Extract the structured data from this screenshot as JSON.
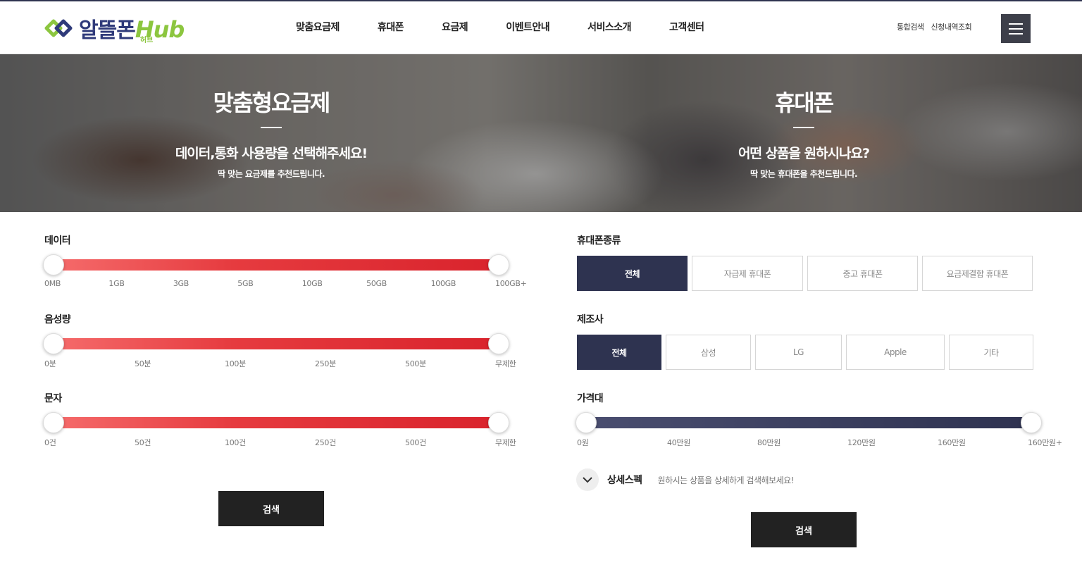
{
  "header": {
    "logo_text": "알뜰폰",
    "logo_hub": "Hub",
    "logo_sub": "허브",
    "nav": [
      "맞춤요금제",
      "휴대폰",
      "요금제",
      "이벤트안내",
      "서비스소개",
      "고객센터"
    ],
    "util": [
      "통합검색",
      "신청내역조회"
    ]
  },
  "hero": {
    "left": {
      "title": "맞춤형요금제",
      "subtitle": "데이터,통화 사용량을 선택해주세요!",
      "desc": "딱 맞는 요금제를 추천드립니다."
    },
    "right": {
      "title": "휴대폰",
      "subtitle": "어떤 상품을 원하시나요?",
      "desc": "딱 맞는 휴대폰을 추천드립니다."
    }
  },
  "plan": {
    "data": {
      "label": "데이터",
      "ticks": [
        "0MB",
        "1GB",
        "3GB",
        "5GB",
        "10GB",
        "50GB",
        "100GB",
        "100GB+"
      ],
      "range": [
        "0MB",
        "100GB+"
      ]
    },
    "voice": {
      "label": "음성량",
      "ticks": [
        "0분",
        "50분",
        "100분",
        "250분",
        "500분",
        "무제한"
      ],
      "range": [
        "0분",
        "무제한"
      ]
    },
    "sms": {
      "label": "문자",
      "ticks": [
        "0건",
        "50건",
        "100건",
        "250건",
        "500건",
        "무제한"
      ],
      "range": [
        "0건",
        "무제한"
      ]
    },
    "search_label": "검색"
  },
  "phone": {
    "type": {
      "label": "휴대폰종류",
      "options": [
        "전체",
        "자급제 휴대폰",
        "중고 휴대폰",
        "요금제결합 휴대폰"
      ],
      "selected": "전체"
    },
    "maker": {
      "label": "제조사",
      "options": [
        "전체",
        "삼성",
        "LG",
        "Apple",
        "기타"
      ],
      "selected": "전체"
    },
    "price": {
      "label": "가격대",
      "ticks": [
        "0원",
        "40만원",
        "80만원",
        "120만원",
        "160만원",
        "160만원+"
      ],
      "range": [
        "0원",
        "160만원+"
      ]
    },
    "detail_title": "상세스펙",
    "detail_desc": "원하시는 상품을 상세하게 검색해보세요!",
    "search_label": "검색"
  },
  "colors": {
    "navy": "#2e3350",
    "red": "#d9232c",
    "logo_blue": "#2f3a7a",
    "logo_green": "#8cc63f"
  },
  "icons": {
    "menu": "hamburger-icon",
    "detail_toggle": "chevron-down-icon",
    "logo_mark": "interlocking-diamond-icon"
  }
}
